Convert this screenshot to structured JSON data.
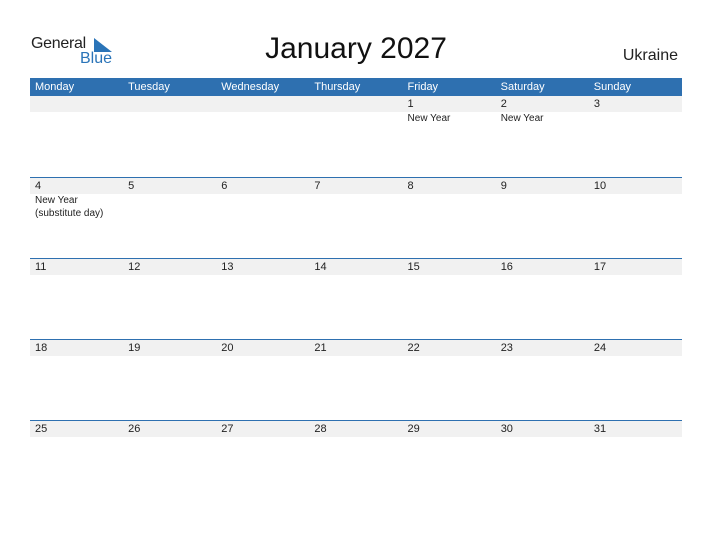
{
  "logo": {
    "general": "General",
    "blue": "Blue"
  },
  "title": "January 2027",
  "country": "Ukraine",
  "colors": {
    "accent": "#2e70b0",
    "band": "#f1f1f1"
  },
  "weekdays": [
    "Monday",
    "Tuesday",
    "Wednesday",
    "Thursday",
    "Friday",
    "Saturday",
    "Sunday"
  ],
  "weeks": [
    [
      {
        "day": "",
        "event": ""
      },
      {
        "day": "",
        "event": ""
      },
      {
        "day": "",
        "event": ""
      },
      {
        "day": "",
        "event": ""
      },
      {
        "day": "1",
        "event": "New Year"
      },
      {
        "day": "2",
        "event": "New Year"
      },
      {
        "day": "3",
        "event": ""
      }
    ],
    [
      {
        "day": "4",
        "event": "New Year (substitute day)"
      },
      {
        "day": "5",
        "event": ""
      },
      {
        "day": "6",
        "event": ""
      },
      {
        "day": "7",
        "event": ""
      },
      {
        "day": "8",
        "event": ""
      },
      {
        "day": "9",
        "event": ""
      },
      {
        "day": "10",
        "event": ""
      }
    ],
    [
      {
        "day": "11",
        "event": ""
      },
      {
        "day": "12",
        "event": ""
      },
      {
        "day": "13",
        "event": ""
      },
      {
        "day": "14",
        "event": ""
      },
      {
        "day": "15",
        "event": ""
      },
      {
        "day": "16",
        "event": ""
      },
      {
        "day": "17",
        "event": ""
      }
    ],
    [
      {
        "day": "18",
        "event": ""
      },
      {
        "day": "19",
        "event": ""
      },
      {
        "day": "20",
        "event": ""
      },
      {
        "day": "21",
        "event": ""
      },
      {
        "day": "22",
        "event": ""
      },
      {
        "day": "23",
        "event": ""
      },
      {
        "day": "24",
        "event": ""
      }
    ],
    [
      {
        "day": "25",
        "event": ""
      },
      {
        "day": "26",
        "event": ""
      },
      {
        "day": "27",
        "event": ""
      },
      {
        "day": "28",
        "event": ""
      },
      {
        "day": "29",
        "event": ""
      },
      {
        "day": "30",
        "event": ""
      },
      {
        "day": "31",
        "event": ""
      }
    ]
  ]
}
